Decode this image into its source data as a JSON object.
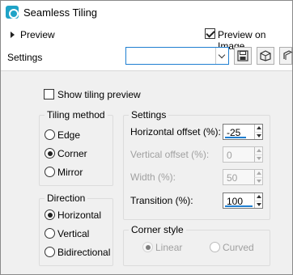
{
  "window": {
    "title": "Seamless Tiling",
    "app_icon": "seamless-tiling-app-icon"
  },
  "preview": {
    "label": "Preview",
    "preview_on_image_label": "Preview on Image",
    "preview_on_image_checked": true
  },
  "settings": {
    "label": "Settings",
    "preset_value": "",
    "tools": [
      "save-preset-icon",
      "randomize-icon",
      "reset-icon"
    ]
  },
  "show_tiling_preview": {
    "label": "Show tiling preview",
    "checked": false
  },
  "tiling_method": {
    "title": "Tiling method",
    "options": [
      "Edge",
      "Corner",
      "Mirror"
    ],
    "selected": "Corner"
  },
  "direction": {
    "title": "Direction",
    "options": [
      "Horizontal",
      "Vertical",
      "Bidirectional"
    ],
    "selected": "Horizontal"
  },
  "settings_group": {
    "title": "Settings",
    "fields": [
      {
        "label": "Horizontal offset (%):",
        "value": "-25",
        "enabled": true,
        "bar_fraction": 0.75
      },
      {
        "label": "Vertical offset (%):",
        "value": "0",
        "enabled": false,
        "bar_fraction": 0.5
      },
      {
        "label": "Width (%):",
        "value": "50",
        "enabled": false,
        "bar_fraction": 0.5
      },
      {
        "label": "Transition (%):",
        "value": "100",
        "enabled": true,
        "bar_fraction": 1.0
      }
    ]
  },
  "corner_style": {
    "title": "Corner style",
    "options": [
      "Linear",
      "Curved"
    ],
    "selected": "Linear",
    "enabled": false
  },
  "colors": {
    "accent": "#1f7fd1",
    "panel": "#f0f0f0"
  }
}
